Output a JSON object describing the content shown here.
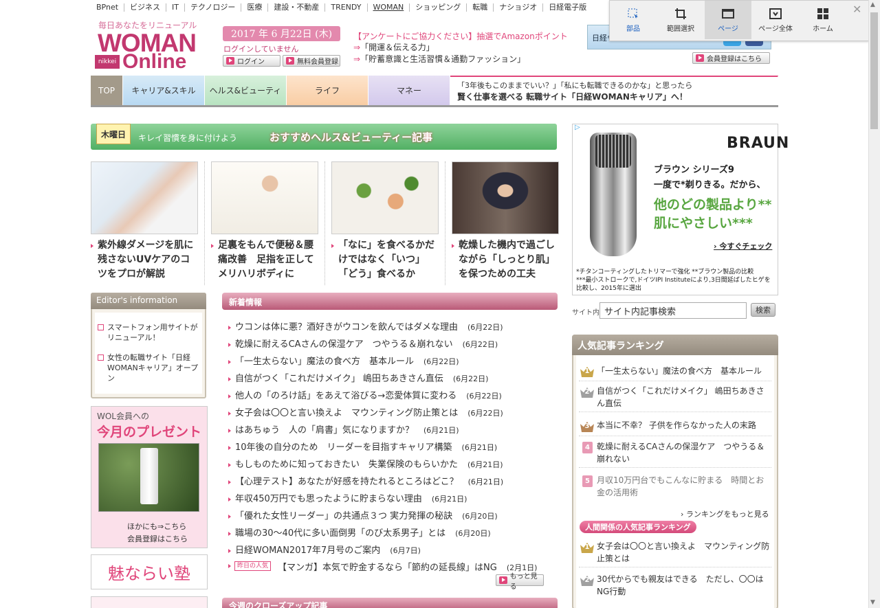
{
  "topnav": [
    "BPnet",
    "ビジネス",
    "IT",
    "テクノロジー",
    "医療",
    "建設・不動産",
    "TRENDY",
    "WOMAN",
    "ショッピング",
    "転職",
    "ナショジオ",
    "日経電子版"
  ],
  "header": {
    "tagline": "毎日あなたをリニューアル",
    "logo_line1": "WOMAN",
    "logo_line2": "Online",
    "logo_badge": "nikkei",
    "date": "2017 年 6 月22日 (木)",
    "login_status": "ログインしていません",
    "login_button": "ログイン",
    "register_button": "無料会員登録",
    "promo_main": "【アンケートにご協力ください】抽選でAmazonポイント",
    "promo_arrow": "⇒",
    "promo_link1": "「開運＆伝える力」",
    "promo_link2": "「貯蓄意識と生活習慣＆通勤ファッション」",
    "follow_text": "日経ウーマンオンラインをフォロー",
    "twitter_glyph": "t",
    "facebook_glyph": "f",
    "member_register": "会員登録はこちら"
  },
  "catnav": {
    "top": "TOP",
    "career": "キャリア&スキル",
    "health": "ヘルス&ビューティ",
    "life": "ライフ",
    "money": "マネー",
    "ad_line1": "「3年後もこのままでいい？」「私にも転職できるのかな」と思ったら",
    "ad_line2": "賢く仕事を選べる 転職サイト「日経WOMANキャリア」へ！"
  },
  "banner": {
    "day": "木曜日",
    "text1": "キレイ習慣を身に付けよう",
    "text2": "おすすめヘルス&ビューティー記事"
  },
  "features": [
    {
      "text": "紫外線ダメージを肌に残さないUVケアのコツをプロが解説"
    },
    {
      "text": "足裏をもんで便秘＆腰痛改善　足指を正して メリハリボディに"
    },
    {
      "text": "「なに」を食べるかだけではなく「いつ」「どう」食べるか"
    },
    {
      "text": "乾燥した機内で過ごしながら「しっとり肌」を保つための工夫"
    }
  ],
  "editors": {
    "title": "Editor's information",
    "items": [
      "スマートフォン用サイトがリニューアル！",
      "女性の転職サイト「日経WOMANキャリア」オープン"
    ]
  },
  "present": {
    "line1": "WOL会員への",
    "line2": "今月のプレゼント",
    "link1": "ほかにも⇒こちら",
    "link2": "会員登録はこちら",
    "banner": "魅ならい塾"
  },
  "news": {
    "title": "新着情報",
    "items": [
      {
        "title": "ウコンは体に悪？酒好きがウコンを飲んではダメな理由",
        "date": "(6月22日)"
      },
      {
        "title": "乾燥に耐えるCAさんの保湿ケア　つやうる＆崩れない",
        "date": "(6月22日)"
      },
      {
        "title": "「一生太らない」魔法の食べ方　基本ルール",
        "date": "(6月22日)"
      },
      {
        "title": "自信がつく「これだけメイク」 嶋田ちあきさん直伝",
        "date": "(6月22日)"
      },
      {
        "title": "他人の「のろけ話」をあえて浴びる→恋愛体質に変わる",
        "date": "(6月22日)"
      },
      {
        "title": "女子会は〇〇と言い換えよ　マウンティング防止策とは",
        "date": "(6月22日)"
      },
      {
        "title": "はあちゅう　人の「肩書」気になりますか？",
        "date": "(6月21日)"
      },
      {
        "title": "10年後の自分のため　リーダーを目指すキャリア構築",
        "date": "(6月21日)"
      },
      {
        "title": "もしものために知っておきたい　失業保険のもらいかた",
        "date": "(6月21日)"
      },
      {
        "title": "【心理テスト】あなたが好感を持たれるところはどこ？",
        "date": "(6月21日)"
      },
      {
        "title": "年収450万円でも思ったように貯まらない理由",
        "date": "(6月21日)"
      },
      {
        "title": "「優れた女性リーダー」の共通点３つ 実力発揮の秘訣",
        "date": "(6月20日)"
      },
      {
        "title": "職場の30～40代に多い面倒男「のび太系男子」とは",
        "date": "(6月20日)"
      },
      {
        "title": "日経WOMAN2017年7月号のご案内",
        "date": "(6月7日)"
      },
      {
        "title": "【マンガ】本気で貯金するなら「節約の延長線」はNG",
        "date": "(2月1日)"
      }
    ],
    "yesterday_badge": "昨日の人気",
    "more": "もっと見る",
    "closeup_title": "今週のクローズアップ記事"
  },
  "ad": {
    "choices": "▷",
    "brand": "BRAUN",
    "line1": "ブラウン シリーズ9",
    "line2": "一度で*剃りきる。だから、",
    "line3": "他のどの製品より**",
    "line4": "肌にやさしい***",
    "cta": "› 今すぐチェック",
    "note1": "*チタンコーティングしたトリマーで強化 **ブラウン製品の比較",
    "note2": "***最小ストロークで,ドイツIPI Instituteにより,3日間延ばしたヒゲを",
    "note3": "比較し、2015年に選出"
  },
  "search": {
    "label": "サイト内",
    "value": "サイト内記事検索",
    "button": "検索"
  },
  "ranking": {
    "title": "人気記事ランキング",
    "items": [
      {
        "rank": "1",
        "title": "「一生太らない」魔法の食べ方　基本ルール"
      },
      {
        "rank": "2",
        "title": "自信がつく「これだけメイク」 嶋田ちあきさん直伝"
      },
      {
        "rank": "3",
        "title": "本当に不幸？ 子供を作らなかった人の末路"
      },
      {
        "rank": "4",
        "title": "乾燥に耐えるCAさんの保湿ケア　つやうる＆崩れない"
      },
      {
        "rank": "5",
        "title": "月収10万円台でもこんなに貯まる　時間とお金の活用術"
      }
    ],
    "more": "› ランキングをもっと見る",
    "rel_title": "人間関係の人気記事ランキング",
    "rel_items": [
      {
        "rank": "1",
        "title": "女子会は〇〇と言い換えよ　マウンティング防止策とは"
      },
      {
        "rank": "2",
        "title": "30代からでも親友はできる　ただし、〇〇はNG行動"
      }
    ]
  },
  "toolbar": {
    "buttons": [
      "部品",
      "範囲選択",
      "ページ",
      "ページ全体",
      "ホーム"
    ],
    "close": "✕"
  },
  "scrollbar": {
    "up": "▲",
    "down": "▼"
  }
}
